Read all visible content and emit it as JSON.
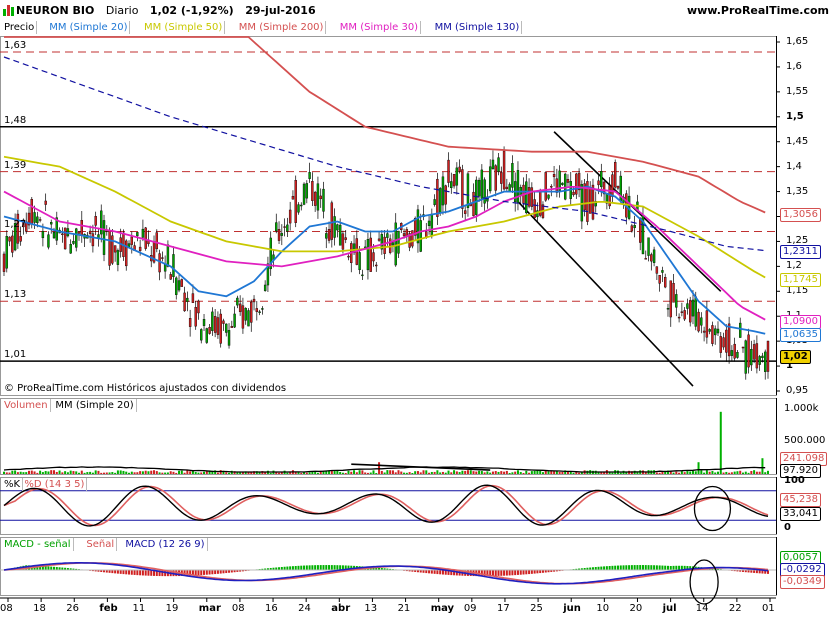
{
  "header": {
    "instrument": "NEURON BIO",
    "period": "Diario",
    "price_change": "1,02 (-1,92%)",
    "date": "29-jul-2016",
    "site": "www.ProRealTime.com"
  },
  "price_panel": {
    "tabs": [
      {
        "label": "Precio",
        "color": "#000000"
      },
      {
        "label": "MM (Simple 20)",
        "color": "#1f77d4"
      },
      {
        "label": "MM (Simple 50)",
        "color": "#c8c800"
      },
      {
        "label": "MM (Simple 200)",
        "color": "#d45050"
      },
      {
        "label": "MM (Simple 30)",
        "color": "#e020c0"
      },
      {
        "label": "MM (Simple 130)",
        "color": "#1010a0"
      }
    ],
    "credit": "© ProRealTime.com Históricos ajustados con dividendos",
    "level_labels": [
      "1,63",
      "1,48",
      "1,39",
      "1,27",
      "1,13",
      "1,01"
    ],
    "axis_ticks": [
      "1,65",
      "1,6",
      "1,55",
      "1,5",
      "1,45",
      "1,4",
      "1,35",
      "1,3",
      "1,25",
      "1,2",
      "1,15",
      "1,1",
      "1,05",
      "1",
      "0,95"
    ],
    "price_boxes": [
      {
        "text": "1,3056",
        "color": "#d45050"
      },
      {
        "text": "1,2311",
        "color": "#1010a0"
      },
      {
        "text": "1,1745",
        "color": "#c8c800"
      },
      {
        "text": "1,0900",
        "color": "#e020c0"
      },
      {
        "text": "1,0635",
        "color": "#1f77d4"
      },
      {
        "text": "1,02",
        "color": "#000000"
      }
    ]
  },
  "volume_panel": {
    "tabs": [
      {
        "label": "Volumen",
        "color": "#d45050"
      },
      {
        "label": "MM (Simple 20)",
        "color": "#000000"
      }
    ],
    "axis_ticks": [
      "1.000k",
      "500.000"
    ],
    "value_boxes": [
      "241.098",
      "97.920"
    ]
  },
  "stoch_panel": {
    "tabs": [
      {
        "label": "%K",
        "color": "#000000"
      },
      {
        "label": "%D (14 3 5)",
        "color": "#d45050"
      }
    ],
    "axis_ticks": [
      "100",
      "0"
    ],
    "value_boxes": [
      "45,238",
      "33,041"
    ]
  },
  "macd_panel": {
    "tabs": [
      {
        "label": "MACD - señal",
        "color": "#00a000"
      },
      {
        "label": "Señal",
        "color": "#d45050"
      },
      {
        "label": "MACD (12 26 9)",
        "color": "#1010a0"
      }
    ],
    "value_boxes": [
      "0,0057",
      "-0,0292",
      "-0,0349"
    ]
  },
  "time_axis": [
    "08",
    "18",
    "26",
    "feb",
    "11",
    "19",
    "mar",
    "08",
    "16",
    "24",
    "abr",
    "13",
    "21",
    "may",
    "09",
    "17",
    "25",
    "jun",
    "10",
    "20",
    "jul",
    "14",
    "22",
    "01"
  ],
  "chart_data": {
    "type": "line",
    "title": "NEURON BIO Diario",
    "x_range": [
      "enero 2016",
      "01 agosto 2016"
    ],
    "ylim": [
      0.95,
      1.65
    ],
    "grid": false,
    "horizontal_levels": [
      1.63,
      1.48,
      1.39,
      1.27,
      1.13,
      1.01
    ],
    "series": [
      {
        "name": "Precio",
        "points": [
          [
            0,
            1.22
          ],
          [
            10,
            1.32
          ],
          [
            20,
            1.25
          ],
          [
            30,
            1.28
          ],
          [
            40,
            1.24
          ],
          [
            50,
            1.25
          ],
          [
            60,
            1.2
          ],
          [
            70,
            1.1
          ],
          [
            80,
            1.07
          ],
          [
            90,
            1.12
          ],
          [
            100,
            1.28
          ],
          [
            110,
            1.37
          ],
          [
            120,
            1.27
          ],
          [
            130,
            1.21
          ],
          [
            140,
            1.25
          ],
          [
            150,
            1.27
          ],
          [
            160,
            1.38
          ],
          [
            170,
            1.33
          ],
          [
            180,
            1.4
          ],
          [
            190,
            1.33
          ],
          [
            200,
            1.37
          ],
          [
            210,
            1.33
          ],
          [
            220,
            1.38
          ],
          [
            230,
            1.26
          ],
          [
            240,
            1.14
          ],
          [
            250,
            1.1
          ],
          [
            260,
            1.05
          ],
          [
            270,
            1.02
          ],
          [
            275,
            1.02
          ]
        ]
      },
      {
        "name": "MM (Simple 20)",
        "points": [
          [
            0,
            1.3
          ],
          [
            20,
            1.27
          ],
          [
            40,
            1.25
          ],
          [
            60,
            1.2
          ],
          [
            70,
            1.15
          ],
          [
            80,
            1.14
          ],
          [
            90,
            1.17
          ],
          [
            100,
            1.23
          ],
          [
            110,
            1.28
          ],
          [
            120,
            1.29
          ],
          [
            130,
            1.27
          ],
          [
            140,
            1.27
          ],
          [
            150,
            1.3
          ],
          [
            160,
            1.31
          ],
          [
            170,
            1.33
          ],
          [
            180,
            1.35
          ],
          [
            190,
            1.35
          ],
          [
            200,
            1.35
          ],
          [
            210,
            1.36
          ],
          [
            220,
            1.34
          ],
          [
            230,
            1.29
          ],
          [
            240,
            1.21
          ],
          [
            250,
            1.13
          ],
          [
            260,
            1.08
          ],
          [
            270,
            1.07
          ],
          [
            275,
            1.0635
          ]
        ]
      },
      {
        "name": "MM (Simple 50)",
        "points": [
          [
            0,
            1.42
          ],
          [
            20,
            1.4
          ],
          [
            40,
            1.35
          ],
          [
            60,
            1.29
          ],
          [
            80,
            1.25
          ],
          [
            100,
            1.23
          ],
          [
            120,
            1.23
          ],
          [
            140,
            1.24
          ],
          [
            160,
            1.27
          ],
          [
            180,
            1.29
          ],
          [
            200,
            1.32
          ],
          [
            215,
            1.33
          ],
          [
            230,
            1.32
          ],
          [
            250,
            1.26
          ],
          [
            270,
            1.19
          ],
          [
            275,
            1.1745
          ]
        ]
      },
      {
        "name": "MM (Simple 200)",
        "points": [
          [
            0,
            1.85
          ],
          [
            40,
            1.8
          ],
          [
            80,
            1.7
          ],
          [
            110,
            1.55
          ],
          [
            130,
            1.48
          ],
          [
            160,
            1.44
          ],
          [
            190,
            1.43
          ],
          [
            210,
            1.43
          ],
          [
            230,
            1.41
          ],
          [
            250,
            1.38
          ],
          [
            265,
            1.33
          ],
          [
            275,
            1.3056
          ]
        ]
      },
      {
        "name": "MM (Simple 30)",
        "points": [
          [
            0,
            1.35
          ],
          [
            20,
            1.29
          ],
          [
            40,
            1.27
          ],
          [
            60,
            1.24
          ],
          [
            80,
            1.21
          ],
          [
            100,
            1.2
          ],
          [
            120,
            1.22
          ],
          [
            140,
            1.25
          ],
          [
            150,
            1.27
          ],
          [
            160,
            1.28
          ],
          [
            170,
            1.3
          ],
          [
            180,
            1.33
          ],
          [
            190,
            1.35
          ],
          [
            205,
            1.36
          ],
          [
            220,
            1.35
          ],
          [
            235,
            1.28
          ],
          [
            250,
            1.2
          ],
          [
            265,
            1.12
          ],
          [
            275,
            1.09
          ]
        ]
      },
      {
        "name": "MM (Simple 130)",
        "points": [
          [
            0,
            1.62
          ],
          [
            30,
            1.56
          ],
          [
            60,
            1.5
          ],
          [
            90,
            1.45
          ],
          [
            120,
            1.4
          ],
          [
            150,
            1.36
          ],
          [
            180,
            1.33
          ],
          [
            210,
            1.31
          ],
          [
            240,
            1.27
          ],
          [
            260,
            1.24
          ],
          [
            275,
            1.2311
          ]
        ]
      }
    ],
    "last_values": {
      "Precio": 1.02,
      "MM (Simple 20)": 1.0635,
      "MM (Simple 50)": 1.1745,
      "MM (Simple 200)": 1.3056,
      "MM (Simple 30)": 1.09,
      "MM (Simple 130)": 1.2311
    },
    "volume_last": 241098,
    "volume_ma20_last": 97920,
    "stochastic": {
      "name": "%K / %D (14 3 5)",
      "last_k": 45.238,
      "last_d": 33.041
    },
    "macd": {
      "name": "MACD (12 26 9)",
      "histogram_last": 0.0057,
      "macd_last": -0.0292,
      "signal_last": -0.0349
    }
  }
}
